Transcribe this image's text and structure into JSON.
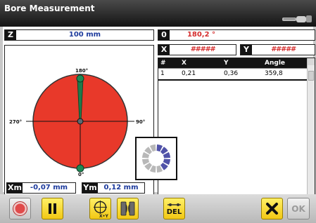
{
  "window": {
    "title": "Bore Measurement"
  },
  "fields": {
    "z": {
      "tag": "Z",
      "value": "100 mm"
    },
    "angle": {
      "tag": "0",
      "value": "180,2 °"
    },
    "x": {
      "tag": "X",
      "value": "#####"
    },
    "y": {
      "tag": "Y",
      "value": "#####"
    },
    "xm": {
      "tag": "Xm",
      "value": "-0,07 mm"
    },
    "ym": {
      "tag": "Ym",
      "value": "0,12 mm"
    }
  },
  "dial": {
    "top_label": "180°",
    "left_label": "270°",
    "right_label": "90°",
    "bottom_label": "0°",
    "fill_color": "#e8392a"
  },
  "table": {
    "headers": [
      "#",
      "X",
      "Y",
      "Angle"
    ],
    "rows": [
      [
        "1",
        "0,21",
        "0,36",
        "359,8"
      ]
    ]
  },
  "loader": {
    "progress": 0.42
  },
  "toolbar": {
    "record": "record-icon",
    "pause": "pause-icon",
    "xy_target": "xy-target-icon",
    "sensor": "sensor-icon",
    "delete_label": "DEL",
    "cancel": "cancel-icon",
    "ok_label": "OK"
  }
}
